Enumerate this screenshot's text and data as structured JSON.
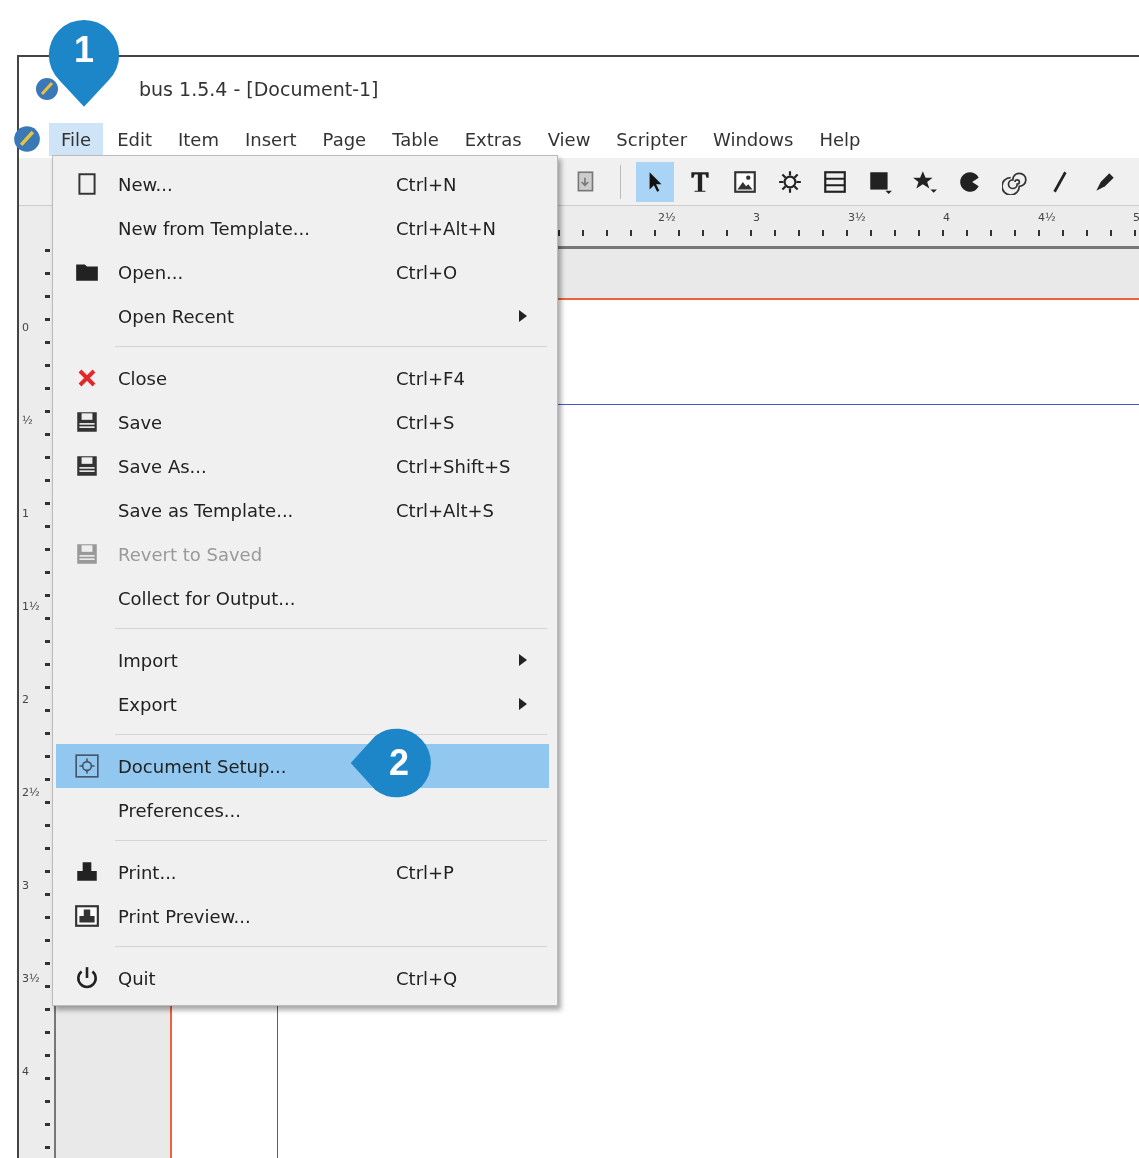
{
  "window": {
    "title": "bus 1.5.4 - [Document-1]"
  },
  "callouts": [
    {
      "label": "1"
    },
    {
      "label": "2"
    }
  ],
  "menu_bar": [
    {
      "label": "File",
      "selected": true
    },
    {
      "label": "Edit",
      "selected": false
    },
    {
      "label": "Item",
      "selected": false
    },
    {
      "label": "Insert",
      "selected": false
    },
    {
      "label": "Page",
      "selected": false
    },
    {
      "label": "Table",
      "selected": false
    },
    {
      "label": "Extras",
      "selected": false
    },
    {
      "label": "View",
      "selected": false
    },
    {
      "label": "Scripter",
      "selected": false
    },
    {
      "label": "Windows",
      "selected": false
    },
    {
      "label": "Help",
      "selected": false
    }
  ],
  "toolbar": [
    {
      "selected": false
    },
    {
      "selected": true
    },
    {
      "selected": false
    },
    {
      "selected": false
    },
    {
      "selected": false
    },
    {
      "selected": false
    },
    {
      "selected": false
    },
    {
      "selected": false
    },
    {
      "selected": false
    },
    {
      "selected": false
    },
    {
      "selected": false
    },
    {
      "selected": false
    }
  ],
  "horizontal_ruler": [
    "2½",
    "3",
    "3½",
    "4",
    "4½",
    "5"
  ],
  "vertical_ruler": [
    "0",
    "½",
    "1",
    "1½",
    "2",
    "2½",
    "3",
    "3½",
    "4"
  ],
  "file_menu": [
    {
      "kind": "item",
      "label": "New...",
      "shortcut": "Ctrl+N",
      "submenu": false,
      "disabled": false,
      "selected": false
    },
    {
      "kind": "item",
      "label": "New from Template...",
      "shortcut": "Ctrl+Alt+N",
      "submenu": false,
      "disabled": false,
      "selected": false
    },
    {
      "kind": "item",
      "label": "Open...",
      "shortcut": "Ctrl+O",
      "submenu": false,
      "disabled": false,
      "selected": false
    },
    {
      "kind": "item",
      "label": "Open Recent",
      "submenu": true,
      "disabled": false,
      "selected": false
    },
    {
      "kind": "separator"
    },
    {
      "kind": "item",
      "label": "Close",
      "shortcut": "Ctrl+F4",
      "submenu": false,
      "disabled": false,
      "selected": false
    },
    {
      "kind": "item",
      "label": "Save",
      "shortcut": "Ctrl+S",
      "submenu": false,
      "disabled": false,
      "selected": false
    },
    {
      "kind": "item",
      "label": "Save As...",
      "shortcut": "Ctrl+Shift+S",
      "submenu": false,
      "disabled": false,
      "selected": false
    },
    {
      "kind": "item",
      "label": "Save as Template...",
      "shortcut": "Ctrl+Alt+S",
      "submenu": false,
      "disabled": false,
      "selected": false
    },
    {
      "kind": "item",
      "label": "Revert to Saved",
      "submenu": false,
      "disabled": true,
      "selected": false
    },
    {
      "kind": "item",
      "label": "Collect for Output...",
      "submenu": false,
      "disabled": false,
      "selected": false
    },
    {
      "kind": "separator"
    },
    {
      "kind": "item",
      "label": "Import",
      "submenu": true,
      "disabled": false,
      "selected": false
    },
    {
      "kind": "item",
      "label": "Export",
      "submenu": true,
      "disabled": false,
      "selected": false
    },
    {
      "kind": "separator"
    },
    {
      "kind": "item",
      "label": "Document Setup...",
      "submenu": false,
      "disabled": false,
      "selected": true
    },
    {
      "kind": "item",
      "label": "Preferences...",
      "submenu": false,
      "disabled": false,
      "selected": false
    },
    {
      "kind": "separator"
    },
    {
      "kind": "item",
      "label": "Print...",
      "shortcut": "Ctrl+P",
      "submenu": false,
      "disabled": false,
      "selected": false
    },
    {
      "kind": "item",
      "label": "Print Preview...",
      "submenu": false,
      "disabled": false,
      "selected": false
    },
    {
      "kind": "separator"
    },
    {
      "kind": "item",
      "label": "Quit",
      "shortcut": "Ctrl+Q",
      "submenu": false,
      "disabled": false,
      "selected": false
    }
  ]
}
